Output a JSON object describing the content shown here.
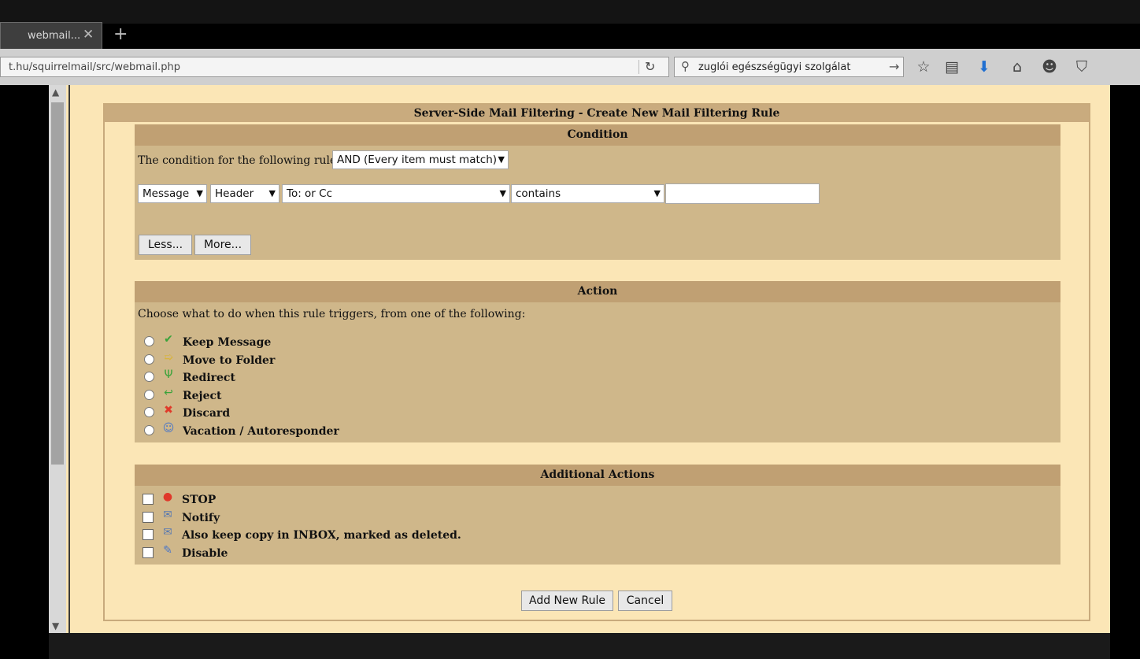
{
  "browser": {
    "tab_title": "webmail...",
    "tab_close": "✕",
    "new_tab": "+",
    "url": "t.hu/squirrelmail/src/webmail.php",
    "search_query": "zuglói egészségügyi szolgálat",
    "icons": [
      "reload-icon",
      "search-icon",
      "go-arrow-icon",
      "star-icon",
      "reading-list-icon",
      "download-icon",
      "home-icon",
      "smiley-icon",
      "pocket-icon"
    ]
  },
  "page_title": "Server-Side Mail Filtering - Create New Mail Filtering Rule",
  "condition": {
    "heading": "Condition",
    "intro": "The condition for the following rules is:",
    "match_mode": "AND (Every item must match)",
    "rule": {
      "field_type": "Message",
      "part": "Header",
      "header": "To: or Cc",
      "operator": "contains",
      "value": ""
    },
    "less_button": "Less...",
    "more_button": "More..."
  },
  "action": {
    "heading": "Action",
    "intro": "Choose what to do when this rule triggers, from one of the following:",
    "options": [
      {
        "label": "Keep Message",
        "icon": "checkmark-icon",
        "color": "#3aa33a"
      },
      {
        "label": "Move to Folder",
        "icon": "folder-arrow-icon",
        "color": "#d8b43a"
      },
      {
        "label": "Redirect",
        "icon": "fork-icon",
        "color": "#3aa33a"
      },
      {
        "label": "Reject",
        "icon": "return-arrow-icon",
        "color": "#3aa33a"
      },
      {
        "label": "Discard",
        "icon": "x-icon",
        "color": "#e03a2a"
      },
      {
        "label": "Vacation / Autoresponder",
        "icon": "person-icon",
        "color": "#4a76c8"
      }
    ]
  },
  "additional": {
    "heading": "Additional Actions",
    "options": [
      {
        "label": "STOP",
        "icon": "stop-icon",
        "color": "#e0382a"
      },
      {
        "label": "Notify",
        "icon": "envelope-icon",
        "color": "#5a7ab0"
      },
      {
        "label": "Also keep copy in INBOX, marked as deleted.",
        "icon": "envelope-delete-icon",
        "color": "#5a7ab0"
      },
      {
        "label": "Disable",
        "icon": "pen-icon",
        "color": "#4a76c8"
      }
    ]
  },
  "buttons": {
    "add": "Add New Rule",
    "cancel": "Cancel"
  }
}
